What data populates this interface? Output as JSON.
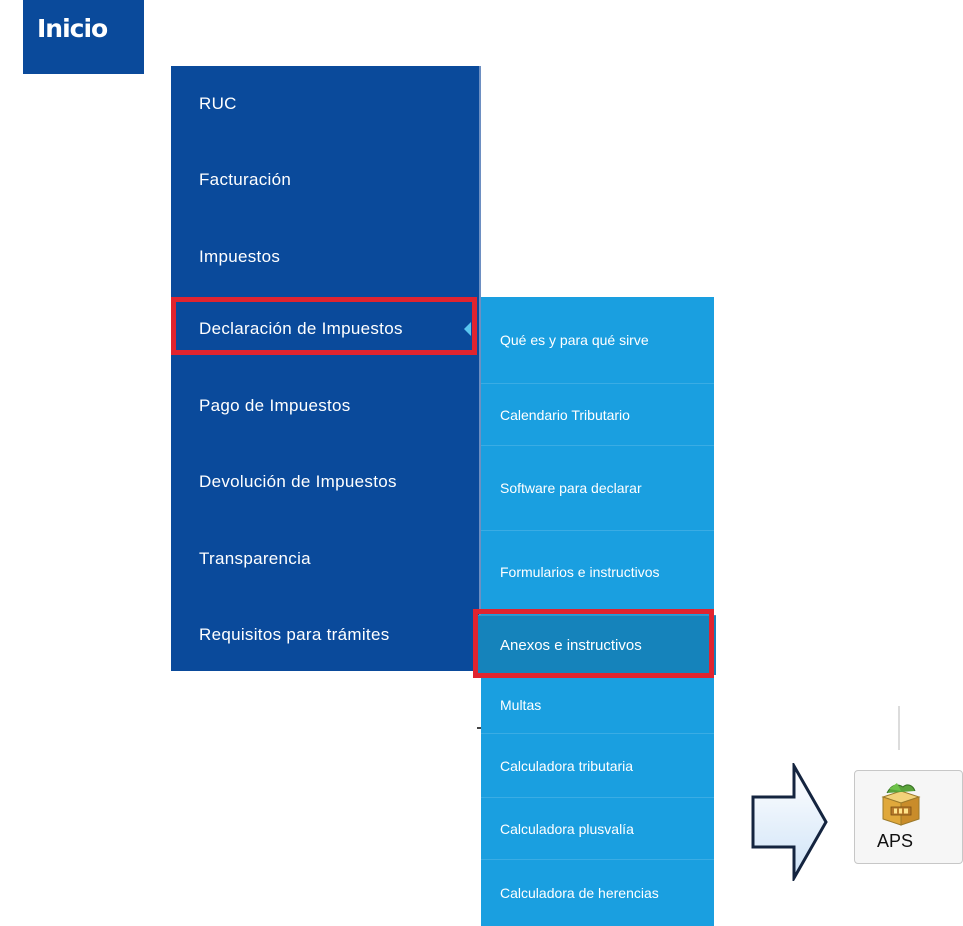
{
  "header": {
    "title": "Inicio"
  },
  "main_menu": {
    "items": [
      {
        "label": "RUC"
      },
      {
        "label": "Facturación"
      },
      {
        "label": "Impuestos"
      },
      {
        "label": "Declaración de Impuestos"
      },
      {
        "label": "Pago de Impuestos"
      },
      {
        "label": "Devolución de Impuestos"
      },
      {
        "label": "Transparencia"
      },
      {
        "label": "Requisitos para trámites"
      }
    ],
    "active_index": 3
  },
  "submenu": {
    "items": [
      {
        "label": "Qué es y para qué sirve"
      },
      {
        "label": "Calendario Tributario"
      },
      {
        "label": "Software para declarar"
      },
      {
        "label": "Formularios e instructivos"
      },
      {
        "label": "Anexos e instructivos"
      },
      {
        "label": "Multas"
      },
      {
        "label": "Calculadora tributaria"
      },
      {
        "label": "Calculadora plusvalía"
      },
      {
        "label": "Calculadora de herencias"
      }
    ],
    "active_index": 4
  },
  "file": {
    "name": "APS",
    "icon": "zip-archive-icon"
  },
  "colors": {
    "main_menu_bg": "#0a4a9b",
    "submenu_bg": "#1a9fe0",
    "submenu_active_bg": "#1583bb",
    "highlight": "#e0242f"
  }
}
